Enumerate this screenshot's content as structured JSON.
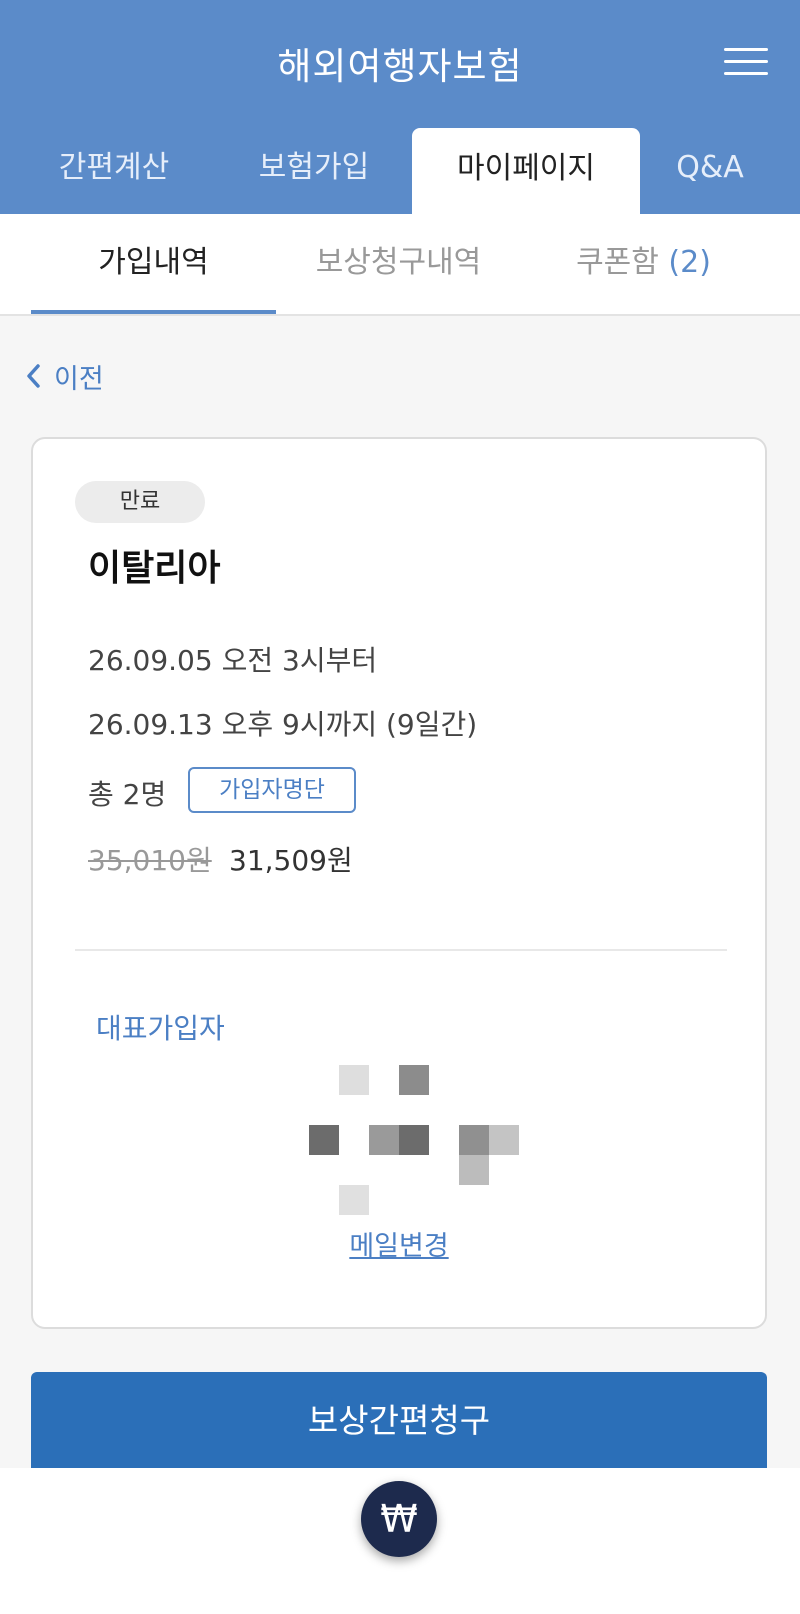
{
  "header": {
    "title": "해외여행자보험",
    "menu_icon": "hamburger-menu-icon"
  },
  "main_tabs": [
    {
      "label": "간편계산",
      "active": false
    },
    {
      "label": "보험가입",
      "active": false
    },
    {
      "label": "마이페이지",
      "active": true
    },
    {
      "label": "Q&A",
      "active": false
    }
  ],
  "sub_tabs": {
    "items": [
      {
        "label": "가입내역",
        "active": true
      },
      {
        "label": "보상청구내역",
        "active": false
      },
      {
        "label": "쿠폰함",
        "count": "(2)",
        "active": false
      }
    ]
  },
  "back": {
    "label": "이전",
    "icon": "chevron-left-icon"
  },
  "policy": {
    "status": "만료",
    "country": "이탈리아",
    "start": "26.09.05 오전 3시부터",
    "end": "26.09.13 오후 9시까지 (9일간)",
    "members": "총 2명",
    "roster_button": "가입자명단",
    "original_price": "35,010원",
    "final_price": "31,509원",
    "representative_label": "대표가입자",
    "change_email": "메일변경"
  },
  "claim_button": "보상간편청구",
  "currency_button": "₩",
  "colors": {
    "header_bg": "#5b8bc9",
    "accent": "#4b7fc4",
    "claim_bg": "#2b6fb8",
    "currency_bg": "#1d2a4d"
  }
}
